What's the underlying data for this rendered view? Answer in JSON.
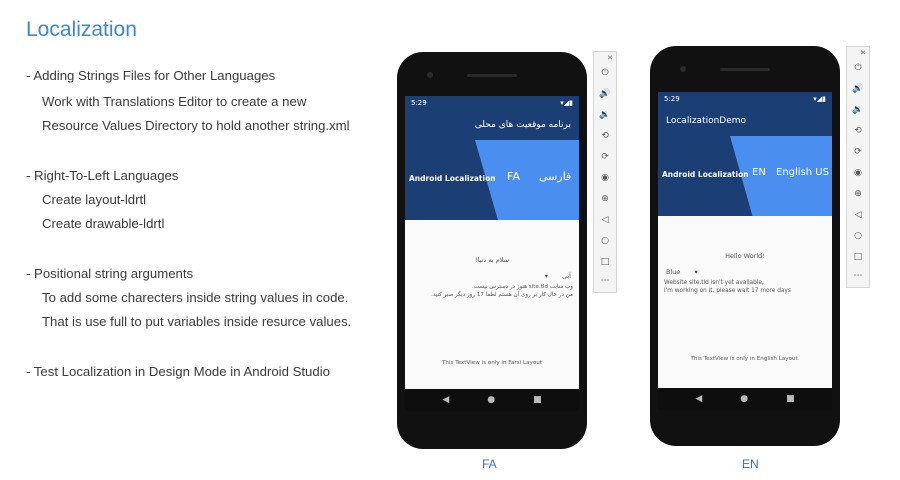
{
  "slide": {
    "title": "Localization",
    "bullets": [
      {
        "head": "- Adding Strings Files for Other Languages",
        "subs": [
          "Work with Translations Editor to create a new",
          "Resource Values Directory to hold another string.xml"
        ]
      },
      {
        "head": "- Right-To-Left Languages",
        "subs": [
          "Create layout-ldrtl",
          "Create drawable-ldrtl"
        ]
      },
      {
        "head": "- Positional string arguments",
        "subs": [
          "To add some charecters inside string values in code.",
          "That is use full to put variables inside resurce values."
        ]
      },
      {
        "head": "- Test Localization in Design Mode in Android Studio",
        "subs": []
      }
    ]
  },
  "phone_fa": {
    "caption": "FA",
    "time": "5:29",
    "status_right": "▾◢▮",
    "app_title": "برنامه موقعیت های محلی",
    "hero_title": "Android Localization",
    "hero_code": "FA",
    "hero_lang": "فارسی",
    "hello": "سلام به دنیا!",
    "spinner_value": "آبی",
    "message_line1": "وب سایت site.tld هنوز در دسترس نیست.",
    "message_line2": "من در حال کار بر روی آن هستم لطفا 17 روز دیگر صبر کنید.",
    "footer": "This TextView is only in Farsi Layout"
  },
  "phone_en": {
    "caption": "EN",
    "time": "5:29",
    "status_right": "▾◢▮",
    "app_title": "LocalizationDemo",
    "hero_title": "Android Localization",
    "hero_code": "EN",
    "hero_lang": "English US",
    "hello": "Hello World!",
    "spinner_value": "Blue",
    "message_line1": "Website site.tld isn't yet available,",
    "message_line2": "I'm working on it, please wait 17 more days",
    "footer": "This TextView is only in English Layout."
  },
  "emulator_controls": [
    "power-icon",
    "volume-up-icon",
    "volume-down-icon",
    "rotate-left-icon",
    "rotate-right-icon",
    "camera-icon",
    "zoom-icon",
    "back-icon",
    "home-icon",
    "overview-icon",
    "more-icon"
  ],
  "colors": {
    "accent": "#3d86d6",
    "hero_dark": "#1b3e74",
    "hero_light": "#4a8ef0"
  }
}
